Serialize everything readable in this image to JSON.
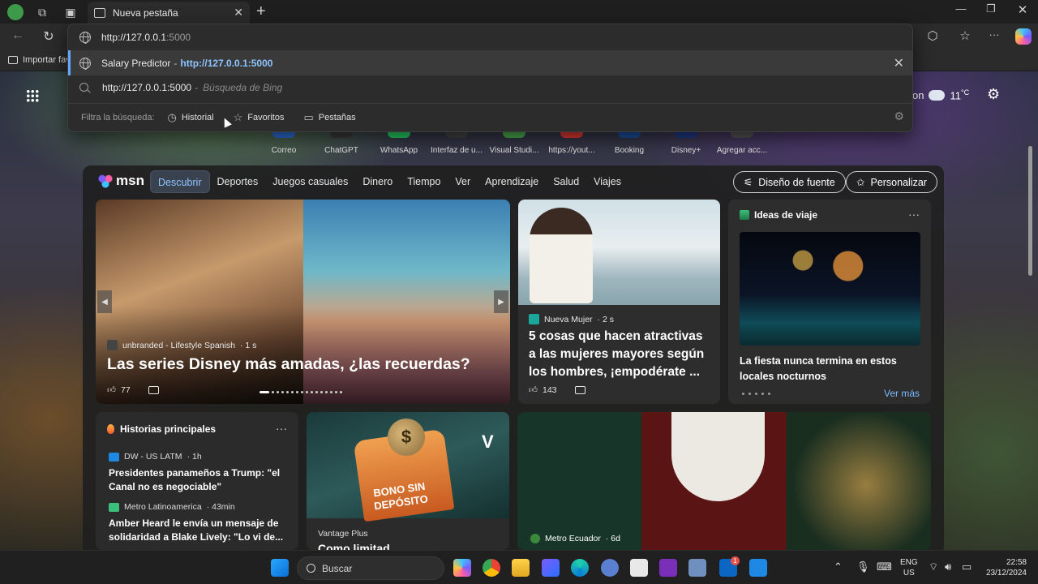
{
  "browser": {
    "tab_title": "Nueva pestaña",
    "favorites_bar_item": "Importar fav"
  },
  "omnibox": {
    "typed_host": "http://127.0.0.1",
    "typed_port": ":5000",
    "suggestion_title": "Salary Predictor",
    "suggestion_separator": "-",
    "suggestion_url": "http://127.0.0.1:5000",
    "bing_query": "http://127.0.0.1:5000",
    "bing_sep": "-",
    "bing_label": "Búsqueda de Bing",
    "filter_label": "Filtra la búsqueda:",
    "filters": [
      "Historial",
      "Favoritos",
      "Pestañas"
    ]
  },
  "ntp": {
    "weather_partial": "on",
    "weather_temp": "11",
    "weather_unit": "°C",
    "quick_links": [
      "Correo",
      "ChatGPT",
      "WhatsApp",
      "Interfaz de u...",
      "Visual Studi...",
      "https://yout...",
      "Booking",
      "Disney+",
      "Agregar acc..."
    ],
    "quick_link_colors": [
      "#2e6fd8",
      "#3a3a3a",
      "#25d366",
      "#444444",
      "#4caf50",
      "#e53935",
      "#1a4fa0",
      "#1e3a8a",
      "#555555"
    ]
  },
  "msn": {
    "logo": "msn",
    "tabs": [
      "Descubrir",
      "Deportes",
      "Juegos casuales",
      "Dinero",
      "Tiempo",
      "Ver",
      "Aprendizaje",
      "Salud",
      "Viajes"
    ],
    "font_button": "Diseño de fuente",
    "personalize_button": "Personalizar",
    "hero": {
      "source": "unbranded - Lifestyle Spanish",
      "age": "· 1 s",
      "headline": "Las series Disney más amadas, ¿las recuerdas?",
      "likes": "77"
    },
    "article": {
      "source": "Nueva Mujer",
      "age": "· 2 s",
      "title": "5 cosas que hacen atractivas a las mujeres mayores según los hombres, ¡empodérate ...",
      "likes": "143"
    },
    "travel": {
      "header": "Ideas de viaje",
      "caption": "La fiesta nunca termina en estos locales nocturnos",
      "link": "Ver más"
    },
    "top_stories": {
      "header": "Historias principales",
      "items": [
        {
          "source": "DW - US LATM",
          "age": "· 1h",
          "title": "Presidentes panameños a Trump: \"el Canal no es negociable\"",
          "color": "#1e88e5"
        },
        {
          "source": "Metro Latinoamerica",
          "age": "· 43min",
          "title": "Amber Heard le envía un mensaje de solidaridad a Blake Lively: \"Lo vi de...",
          "color": "#3bbf7a"
        }
      ]
    },
    "ad": {
      "text_line1": "BONO SIN",
      "text_line2": "DEPÓSITO",
      "sponsor": "Vantage Plus",
      "peek_title": "Como limitad"
    },
    "santa": {
      "source": "Metro Ecuador",
      "age": "· 6d"
    }
  },
  "taskbar": {
    "search_placeholder": "Buscar",
    "lang_top": "ENG",
    "lang_bottom": "US",
    "time": "22:58",
    "date": "23/12/2024",
    "notification_count": "1"
  }
}
